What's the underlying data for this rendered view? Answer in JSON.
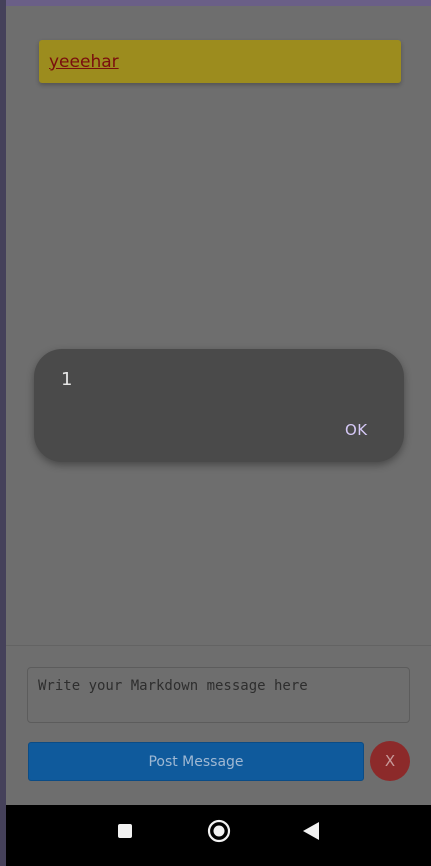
{
  "feed": {
    "messages": [
      {
        "text": "yeeehar"
      }
    ]
  },
  "dialog": {
    "message": "1",
    "ok_label": "OK"
  },
  "composer": {
    "placeholder": "Write your Markdown message here",
    "post_label": "Post Message",
    "close_label": "X"
  },
  "navigation": {
    "icons": [
      "recents-square-icon",
      "home-circle-icon",
      "back-triangle-icon"
    ]
  },
  "colors": {
    "message_card": "#9c8c1e",
    "link": "#7a0d0d",
    "post_button": "#0f5a9c",
    "close_button": "#8c2a2a",
    "dialog_bg": "#4a4a4a",
    "ok_text": "#d6c9f7"
  }
}
